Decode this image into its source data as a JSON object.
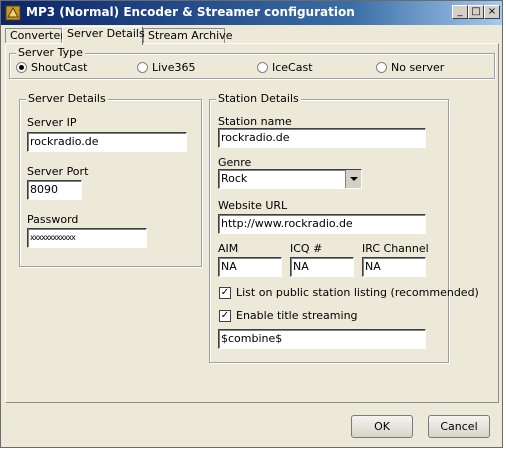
{
  "window": {
    "title": "MP3 (Normal) Encoder & Streamer configuration"
  },
  "titlebar_buttons": {
    "minimize": "_",
    "maximize": "□",
    "close": "×"
  },
  "tabs": [
    {
      "label": "Converter"
    },
    {
      "label": "Server Details"
    },
    {
      "label": "Stream Archive"
    }
  ],
  "server_type": {
    "legend": "Server Type",
    "options": [
      "ShoutCast",
      "Live365",
      "IceCast",
      "No server"
    ],
    "selected": "ShoutCast"
  },
  "server_details": {
    "legend": "Server Details",
    "ip_label": "Server IP",
    "ip_value": "rockradio.de",
    "port_label": "Server Port",
    "port_value": "8090",
    "password_label": "Password",
    "password_value": "xxxxxxxxxxxx"
  },
  "station_details": {
    "legend": "Station Details",
    "name_label": "Station name",
    "name_value": "rockradio.de",
    "genre_label": "Genre",
    "genre_value": "Rock",
    "url_label": "Website URL",
    "url_value": "http://www.rockradio.de",
    "aim_label": "AIM",
    "aim_value": "NA",
    "icq_label": "ICQ #",
    "icq_value": "NA",
    "irc_label": "IRC Channel",
    "irc_value": "NA",
    "list_public_label": "List on public station listing (recommended)",
    "list_public_checked": true,
    "title_streaming_label": "Enable title streaming",
    "title_streaming_checked": true,
    "title_format_value": "$combine$"
  },
  "buttons": {
    "ok": "OK",
    "cancel": "Cancel"
  },
  "check_mark": "✓"
}
